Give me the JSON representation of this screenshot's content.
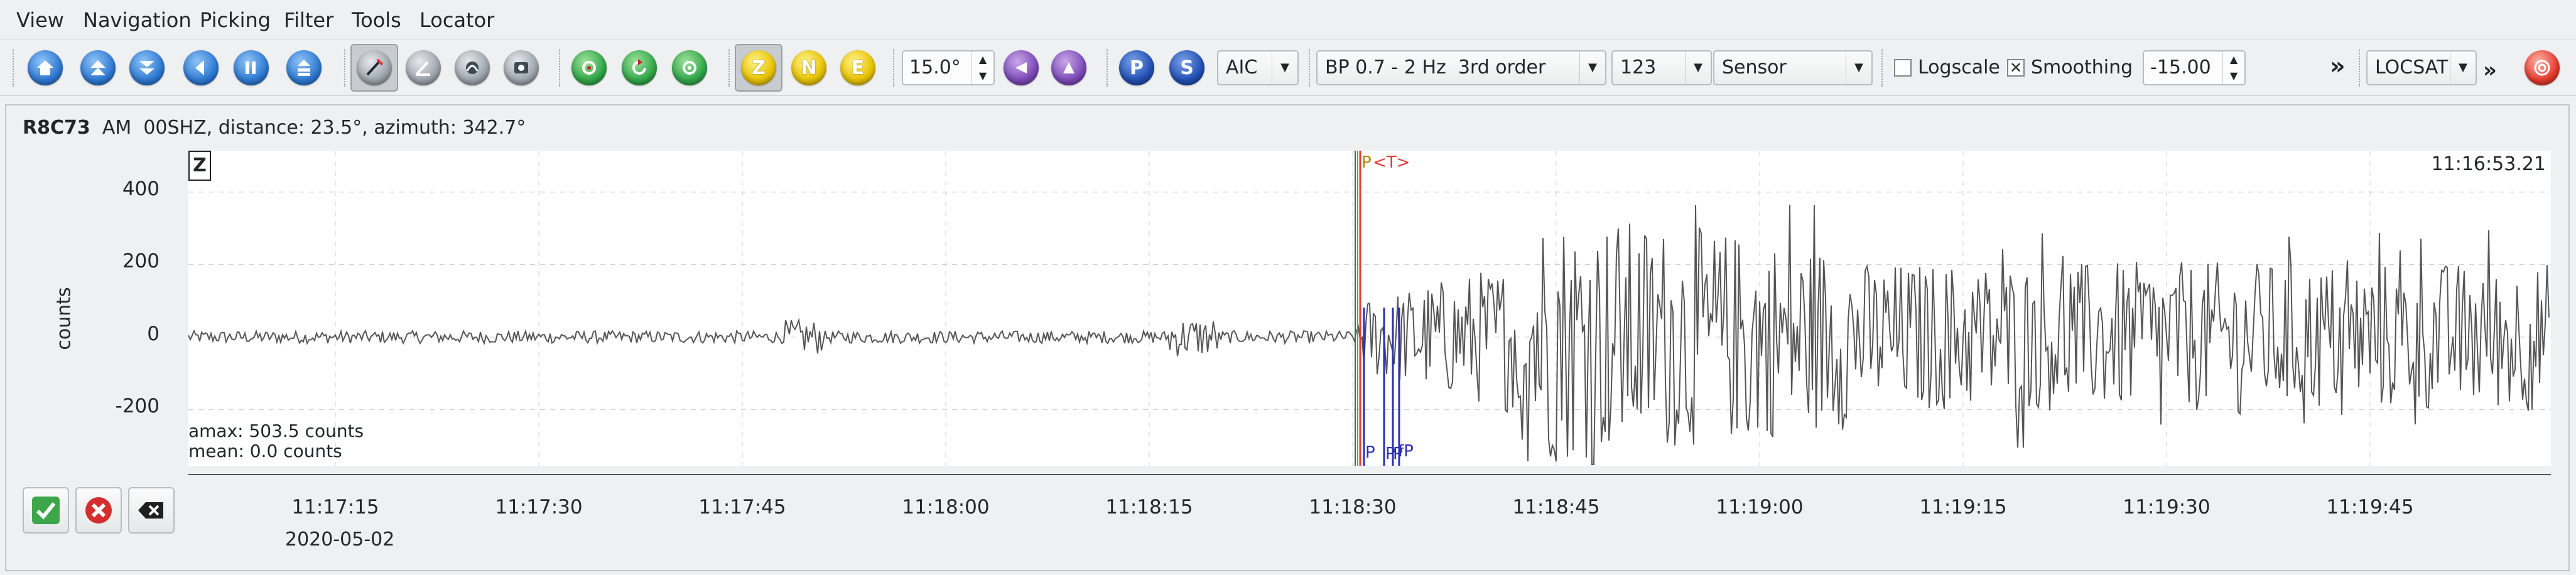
{
  "menubar": {
    "items": [
      "View",
      "Navigation",
      "Picking",
      "Filter",
      "Tools",
      "Locator"
    ]
  },
  "toolbar": {
    "buttons_nav": [
      "home-icon",
      "scroll-up-icon",
      "scroll-down-icon",
      "previous-icon",
      "next-icon",
      "align-icon"
    ],
    "zoom_value": "15.0°",
    "picker_method": "AIC",
    "filter": "BP 0.7 - 2 Hz  3rd order",
    "channel_select": "123",
    "unit_select": "Sensor",
    "logscale_label": "Logscale",
    "logscale_checked": false,
    "smoothing_label": "Smoothing",
    "smoothing_checked": true,
    "smoothing_value": "-15.00",
    "overflow_glyph": "»",
    "locator": "LOCSAT",
    "components": [
      "Z",
      "N",
      "E"
    ],
    "phases": [
      "P",
      "S"
    ]
  },
  "trace": {
    "station": "R8C73",
    "network": "AM",
    "channel_info": "00SHZ, distance: 23.5°, azimuth: 342.7°",
    "component_label": "Z",
    "time_label": "11:16:53.21",
    "ylabel": "counts",
    "yticks": [
      "400",
      "200",
      "0",
      "-200"
    ],
    "xticks": [
      "11:17:15",
      "11:17:30",
      "11:17:45",
      "11:18:00",
      "11:18:15",
      "11:18:30",
      "11:18:45",
      "11:19:00",
      "11:19:15",
      "11:19:30",
      "11:19:45"
    ],
    "date": "2020-05-02",
    "amax": "amax: 503.5 counts",
    "mean": "mean: 0.0 counts",
    "pick_top_P": "P",
    "pick_top_T": "<T>",
    "pick_bottom": [
      "P",
      "P",
      "P",
      "fP"
    ],
    "colors": {
      "trace": "#555555",
      "pick_P": "#e53935",
      "pick_theory": "#2b2fb0",
      "arrival_green": "#2e7d32"
    }
  }
}
